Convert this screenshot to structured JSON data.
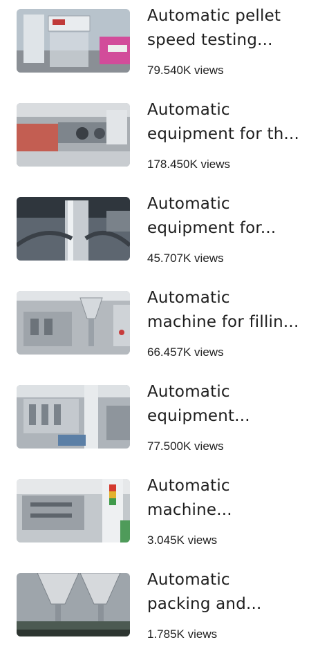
{
  "videos": [
    {
      "title_line1": "Automatic pellet",
      "title_line2": "speed testing...",
      "views": "79.540K views"
    },
    {
      "title_line1": "Automatic",
      "title_line2": "equipment for th...",
      "views": "178.450K views"
    },
    {
      "title_line1": "Automatic",
      "title_line2": "equipment for...",
      "views": "45.707K views"
    },
    {
      "title_line1": "Automatic",
      "title_line2": "machine for fillin...",
      "views": "66.457K views"
    },
    {
      "title_line1": "Automatic",
      "title_line2": "equipment...",
      "views": "77.500K views"
    },
    {
      "title_line1": "Automatic",
      "title_line2": "machine...",
      "views": "3.045K views"
    },
    {
      "title_line1": "Automatic",
      "title_line2": "packing and...",
      "views": "1.785K views"
    }
  ]
}
